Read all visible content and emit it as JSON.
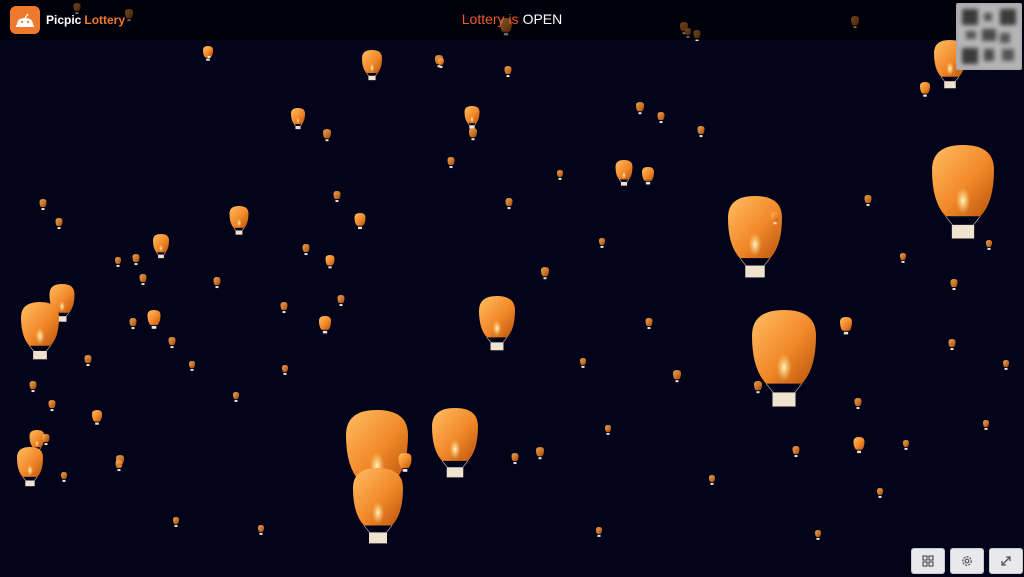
{
  "header": {
    "app_name_primary": "Picpic",
    "app_name_accent": "Lottery",
    "status_word": "Lottery is",
    "status_state": "OPEN"
  },
  "controls": [
    {
      "name": "grid-button",
      "icon": "grid-icon"
    },
    {
      "name": "settings-button",
      "icon": "gear-icon"
    },
    {
      "name": "fullscreen-button",
      "icon": "expand-icon"
    }
  ],
  "colors": {
    "background": "#03031a",
    "accent": "#ef7a2d",
    "status_word": "#f05a2c",
    "lantern_light": "#ffb347",
    "lantern_dark": "#b9540c"
  },
  "scene": {
    "lantern_count": 96
  }
}
